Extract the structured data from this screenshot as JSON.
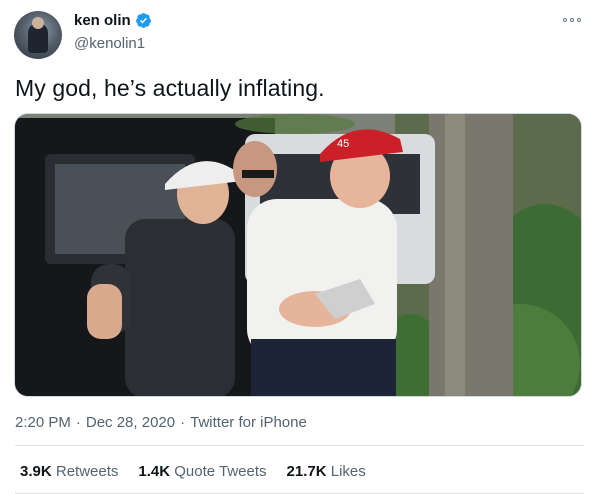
{
  "author": {
    "display_name": "ken olin",
    "handle": "@kenolin1",
    "verified": true
  },
  "icons": {
    "verified": "verified-badge-icon",
    "more": "more-options-icon"
  },
  "tweet": {
    "text": "My god, he’s actually inflating."
  },
  "media": {
    "hat_text": "45"
  },
  "meta": {
    "time": "2:20 PM",
    "separator": "·",
    "date": "Dec 28, 2020",
    "source": "Twitter for iPhone"
  },
  "stats": {
    "retweets": {
      "count": "3.9K",
      "label": "Retweets"
    },
    "quote_tweets": {
      "count": "1.4K",
      "label": "Quote Tweets"
    },
    "likes": {
      "count": "21.7K",
      "label": "Likes"
    }
  },
  "colors": {
    "verified_blue": "#1d9bf0",
    "secondary_text": "#536471",
    "primary_text": "#0f1419"
  }
}
